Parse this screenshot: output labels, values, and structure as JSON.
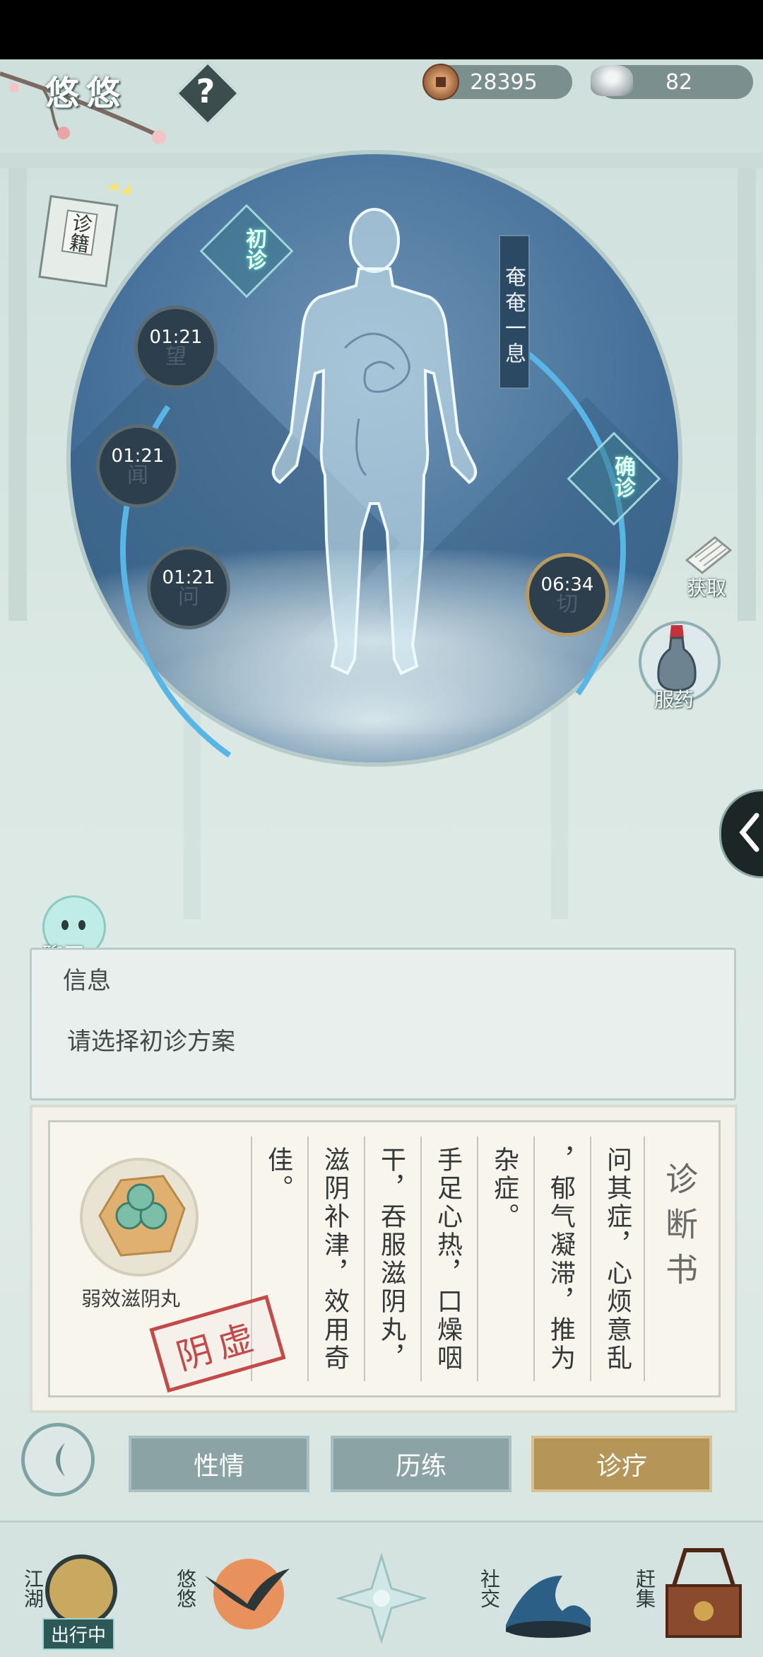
{
  "header": {
    "title": "悠悠",
    "help_label": "?",
    "coins": "28395",
    "silver": "82"
  },
  "left_book": {
    "label": "诊籍"
  },
  "body_panel": {
    "stage_initial": "初诊",
    "stage_final": "确诊",
    "banner": "奄奄一息",
    "timers": [
      {
        "time": "01:21",
        "label": "望"
      },
      {
        "time": "01:21",
        "label": "闻"
      },
      {
        "time": "01:21",
        "label": "问"
      },
      {
        "time": "06:34",
        "label": "切"
      }
    ]
  },
  "side_actions": {
    "obtain": "获取",
    "take_medicine": "服药"
  },
  "chat": {
    "label": "聊天"
  },
  "info": {
    "title": "信息",
    "text": "请选择初诊方案"
  },
  "diagnosis": {
    "heading": "诊断书",
    "columns": [
      "问其症，心烦意乱",
      "，郁气凝滞，推为",
      "杂症。",
      "手足心热，口燥咽",
      "干，吞服滋阴丸，",
      "滋阴补津，效用奇",
      "佳。"
    ],
    "item_name": "弱效滋阴丸",
    "stamp": "阴虚"
  },
  "tabs": {
    "temperament": "性情",
    "training": "历练",
    "treatment": "诊疗",
    "active": "诊疗"
  },
  "nav": {
    "jianghu": "江湖",
    "jianghu_status": "出行中",
    "youyou": "悠悠",
    "social": "社交",
    "market": "赶集"
  },
  "colors": {
    "accent_blue": "#58b6e6",
    "active_tab": "#b69658",
    "stamp_red": "#c44a4a"
  }
}
